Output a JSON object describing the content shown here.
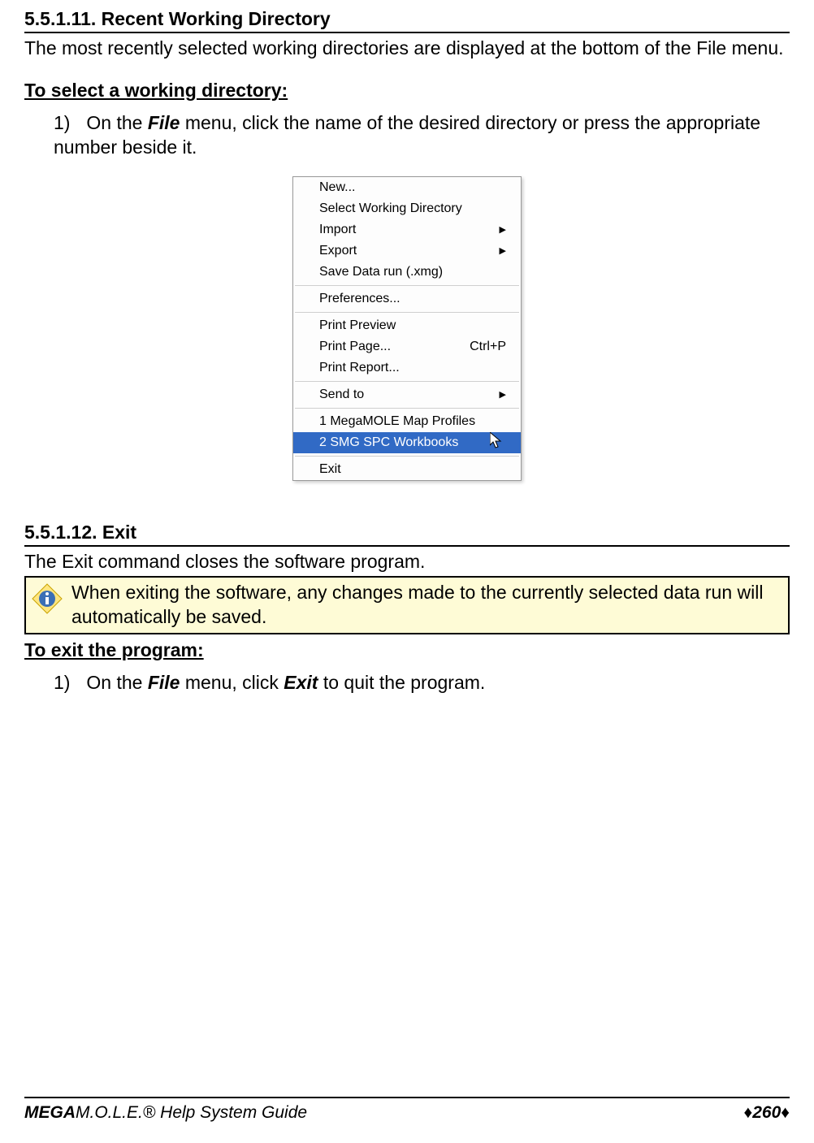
{
  "section1": {
    "heading": "5.5.1.11. Recent Working Directory",
    "intro": "The most recently selected working directories are displayed at the bottom of the File menu.",
    "sub": "To select a working directory:",
    "step_num": "1)",
    "step_pre": "On the ",
    "step_bold1": "File",
    "step_post": " menu, click the name of the desired directory or press the appropriate number beside it."
  },
  "file_menu": {
    "items": [
      {
        "label": "New...",
        "submenu": false
      },
      {
        "label": "Select Working Directory",
        "submenu": false
      },
      {
        "label": "Import",
        "submenu": true
      },
      {
        "label": "Export",
        "submenu": true
      },
      {
        "label": "Save Data run (.xmg)",
        "submenu": false
      },
      {
        "sep": true
      },
      {
        "label": "Preferences...",
        "submenu": false
      },
      {
        "sep": true
      },
      {
        "label": "Print Preview",
        "submenu": false
      },
      {
        "label": "Print Page...",
        "shortcut": "Ctrl+P",
        "submenu": false
      },
      {
        "label": "Print Report...",
        "submenu": false
      },
      {
        "sep": true
      },
      {
        "label": "Send to",
        "submenu": true
      },
      {
        "sep": true
      },
      {
        "label": "1 MegaMOLE Map Profiles",
        "submenu": false
      },
      {
        "label": "2 SMG SPC Workbooks",
        "highlight": true,
        "cursor": true,
        "submenu": false
      },
      {
        "sep": true
      },
      {
        "label": "Exit",
        "submenu": false
      }
    ]
  },
  "section2": {
    "heading": "5.5.1.12. Exit",
    "intro": "The Exit command closes the software program.",
    "note": "When exiting the software, any changes made to the currently selected data run will automatically be saved.",
    "sub": "To exit the program:",
    "step_num": "1)",
    "step_pre": "On the ",
    "step_bold1": "File",
    "step_mid": " menu, click ",
    "step_bold2": "Exit",
    "step_post": " to quit the program."
  },
  "footer": {
    "left_prefix": "MEGA",
    "left_rest": "M.O.L.E.® Help System Guide",
    "page": "260",
    "diamond": "♦"
  }
}
